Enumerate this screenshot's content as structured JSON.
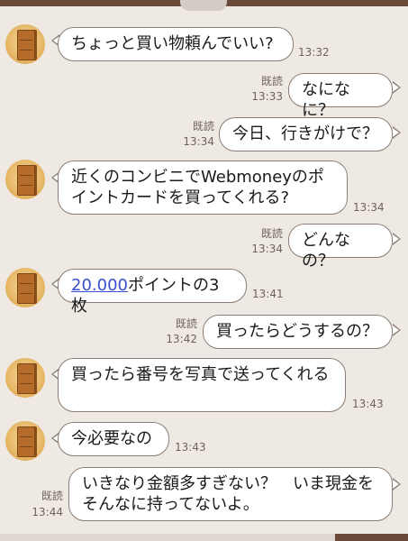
{
  "messages": [
    {
      "side": "left",
      "text": "ちょっと買い物頼んでいい?",
      "time": "13:32"
    },
    {
      "side": "right",
      "text": "なになに？",
      "read": "既読",
      "time": "13:33"
    },
    {
      "side": "right",
      "text": "今日、行きがけで？",
      "read": "既読",
      "time": "13:34"
    },
    {
      "side": "left",
      "text": "近くのコンビニでWebmoneyのポイントカードを買ってくれる?",
      "time": "13:34"
    },
    {
      "side": "right",
      "text": "どんなの？",
      "read": "既読",
      "time": "13:34"
    },
    {
      "side": "left",
      "link": "20.000",
      "text": "ポイントの3枚",
      "time": "13:41"
    },
    {
      "side": "right",
      "text": "買ったらどうするの？",
      "read": "既読",
      "time": "13:42"
    },
    {
      "side": "left",
      "text": "買ったら番号を写真で送ってくれる",
      "time": "13:43"
    },
    {
      "side": "left",
      "text": "今必要なの",
      "time": "13:43"
    },
    {
      "side": "right",
      "text": "いきなり金額多すぎない？　いま現金をそんなに持ってないよ。",
      "read": "既読",
      "time": "13:44"
    }
  ],
  "colors": {
    "background": "#efe9e4",
    "bubble": "#ffffff",
    "border": "#8a7d75",
    "header": "#6b4a3a",
    "link": "#3a4fcf"
  }
}
